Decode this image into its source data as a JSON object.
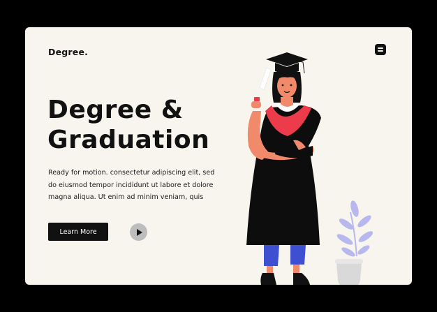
{
  "brand": {
    "logo_text": "Degree."
  },
  "hero": {
    "headline_lines": [
      "Degree &",
      "Graduation"
    ],
    "description_lines": [
      "Ready for motion. consectetur adipiscing elit, sed",
      "do eiusmod tempor incididunt ut labore et dolore",
      "magna aliqua. Ut enim ad minim veniam, quis"
    ],
    "cta_label": "Learn More"
  },
  "icons": {
    "menu": "menu-icon",
    "play": "play-icon",
    "illustration": "graduate-illustration",
    "plant": "potted-plant-icon"
  },
  "colors": {
    "page_bg": "#000000",
    "card_bg": "#f8f5ef",
    "text": "#111111",
    "button_bg": "#111111",
    "play_bg": "#bdbdbd",
    "gown": "#0d0d0d",
    "hood": "#ec3b4a",
    "pants": "#3f4fd1",
    "plant": "#b8b8ef"
  }
}
